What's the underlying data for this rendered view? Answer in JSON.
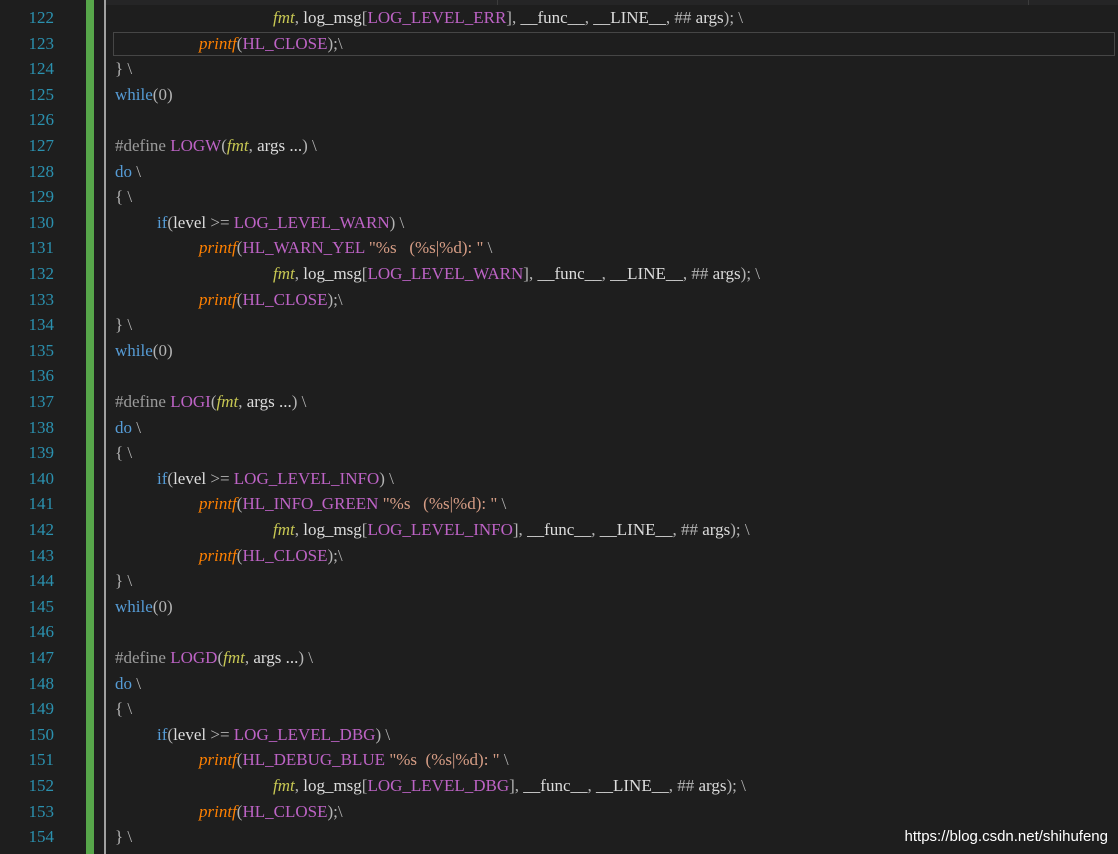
{
  "editor": {
    "watermark": "https://blog.csdn.net/shihufeng",
    "colors": {
      "background": "#1e1e1e",
      "line_number": "#2b91af",
      "keyword": "#569cd6",
      "macro": "#bd63c5",
      "function": "#ff8000",
      "parameter": "#c8c853",
      "string": "#d69d85",
      "preprocessor": "#9b9b9b",
      "change_bar": "#57a64a"
    },
    "line_numbers": [
      "122",
      "123",
      "124",
      "125",
      "126",
      "127",
      "128",
      "129",
      "130",
      "131",
      "132",
      "133",
      "134",
      "135",
      "136",
      "137",
      "138",
      "139",
      "140",
      "141",
      "142",
      "143",
      "144",
      "145",
      "146",
      "147",
      "148",
      "149",
      "150",
      "151",
      "152",
      "153",
      "154"
    ],
    "lines": [
      {
        "indent": 2,
        "tokens": [
          [
            "par",
            "fmt"
          ],
          [
            "op",
            ", "
          ],
          [
            "txt",
            "log_msg"
          ],
          [
            "op",
            "["
          ],
          [
            "mac",
            "LOG_LEVEL_ERR"
          ],
          [
            "op",
            "], "
          ],
          [
            "txt",
            "__func__"
          ],
          [
            "op",
            ", "
          ],
          [
            "txt",
            "__LINE__"
          ],
          [
            "op",
            ", "
          ],
          [
            "op",
            "## "
          ],
          [
            "txt",
            "args"
          ],
          [
            "op",
            "); \\"
          ]
        ]
      },
      {
        "indent": 1,
        "tokens": [
          [
            "fn",
            "printf"
          ],
          [
            "op",
            "("
          ],
          [
            "mac",
            "HL_CLOSE"
          ],
          [
            "op",
            ");\\"
          ]
        ]
      },
      {
        "indent": 0,
        "tokens": [
          [
            "op",
            "} \\"
          ]
        ]
      },
      {
        "indent": 0,
        "tokens": [
          [
            "kw",
            "while"
          ],
          [
            "op",
            "(0)"
          ]
        ]
      },
      {
        "indent": 0,
        "tokens": []
      },
      {
        "indent": 0,
        "tokens": [
          [
            "pp",
            "#define "
          ],
          [
            "mac",
            "LOGW"
          ],
          [
            "op",
            "("
          ],
          [
            "par",
            "fmt"
          ],
          [
            "op",
            ", "
          ],
          [
            "txt",
            "args ..."
          ],
          [
            "op",
            ") \\"
          ]
        ]
      },
      {
        "indent": 0,
        "tokens": [
          [
            "kw",
            "do"
          ],
          [
            "op",
            " \\"
          ]
        ]
      },
      {
        "indent": 0,
        "tokens": [
          [
            "op",
            "{ \\"
          ]
        ]
      },
      {
        "indent": 3,
        "tokens": [
          [
            "kw",
            "if"
          ],
          [
            "op",
            "("
          ],
          [
            "txt",
            "level"
          ],
          [
            "op",
            " >= "
          ],
          [
            "mac",
            "LOG_LEVEL_WARN"
          ],
          [
            "op",
            ") \\"
          ]
        ]
      },
      {
        "indent": 1,
        "tokens": [
          [
            "fn",
            "printf"
          ],
          [
            "op",
            "("
          ],
          [
            "mac",
            "HL_WARN_YEL"
          ],
          [
            "str",
            " \"%s   (%s|%d): \""
          ],
          [
            "op",
            " \\"
          ]
        ]
      },
      {
        "indent": 2,
        "tokens": [
          [
            "par",
            "fmt"
          ],
          [
            "op",
            ", "
          ],
          [
            "txt",
            "log_msg"
          ],
          [
            "op",
            "["
          ],
          [
            "mac",
            "LOG_LEVEL_WARN"
          ],
          [
            "op",
            "], "
          ],
          [
            "txt",
            "__func__"
          ],
          [
            "op",
            ", "
          ],
          [
            "txt",
            "__LINE__"
          ],
          [
            "op",
            ", "
          ],
          [
            "op",
            "## "
          ],
          [
            "txt",
            "args"
          ],
          [
            "op",
            "); \\"
          ]
        ]
      },
      {
        "indent": 1,
        "tokens": [
          [
            "fn",
            "printf"
          ],
          [
            "op",
            "("
          ],
          [
            "mac",
            "HL_CLOSE"
          ],
          [
            "op",
            ");\\"
          ]
        ]
      },
      {
        "indent": 0,
        "tokens": [
          [
            "op",
            "} \\"
          ]
        ]
      },
      {
        "indent": 0,
        "tokens": [
          [
            "kw",
            "while"
          ],
          [
            "op",
            "(0)"
          ]
        ]
      },
      {
        "indent": 0,
        "tokens": []
      },
      {
        "indent": 0,
        "tokens": [
          [
            "pp",
            "#define "
          ],
          [
            "mac",
            "LOGI"
          ],
          [
            "op",
            "("
          ],
          [
            "par",
            "fmt"
          ],
          [
            "op",
            ", "
          ],
          [
            "txt",
            "args ..."
          ],
          [
            "op",
            ") \\"
          ]
        ]
      },
      {
        "indent": 0,
        "tokens": [
          [
            "kw",
            "do"
          ],
          [
            "op",
            " \\"
          ]
        ]
      },
      {
        "indent": 0,
        "tokens": [
          [
            "op",
            "{ \\"
          ]
        ]
      },
      {
        "indent": 3,
        "tokens": [
          [
            "kw",
            "if"
          ],
          [
            "op",
            "("
          ],
          [
            "txt",
            "level"
          ],
          [
            "op",
            " >= "
          ],
          [
            "mac",
            "LOG_LEVEL_INFO"
          ],
          [
            "op",
            ") \\"
          ]
        ]
      },
      {
        "indent": 1,
        "tokens": [
          [
            "fn",
            "printf"
          ],
          [
            "op",
            "("
          ],
          [
            "mac",
            "HL_INFO_GREEN"
          ],
          [
            "str",
            " \"%s   (%s|%d): \""
          ],
          [
            "op",
            " \\"
          ]
        ]
      },
      {
        "indent": 2,
        "tokens": [
          [
            "par",
            "fmt"
          ],
          [
            "op",
            ", "
          ],
          [
            "txt",
            "log_msg"
          ],
          [
            "op",
            "["
          ],
          [
            "mac",
            "LOG_LEVEL_INFO"
          ],
          [
            "op",
            "], "
          ],
          [
            "txt",
            "__func__"
          ],
          [
            "op",
            ", "
          ],
          [
            "txt",
            "__LINE__"
          ],
          [
            "op",
            ", "
          ],
          [
            "op",
            "## "
          ],
          [
            "txt",
            "args"
          ],
          [
            "op",
            "); \\"
          ]
        ]
      },
      {
        "indent": 1,
        "tokens": [
          [
            "fn",
            "printf"
          ],
          [
            "op",
            "("
          ],
          [
            "mac",
            "HL_CLOSE"
          ],
          [
            "op",
            ");\\"
          ]
        ]
      },
      {
        "indent": 0,
        "tokens": [
          [
            "op",
            "} \\"
          ]
        ]
      },
      {
        "indent": 0,
        "tokens": [
          [
            "kw",
            "while"
          ],
          [
            "op",
            "(0)"
          ]
        ]
      },
      {
        "indent": 0,
        "tokens": []
      },
      {
        "indent": 0,
        "tokens": [
          [
            "pp",
            "#define "
          ],
          [
            "mac",
            "LOGD"
          ],
          [
            "op",
            "("
          ],
          [
            "par",
            "fmt"
          ],
          [
            "op",
            ", "
          ],
          [
            "txt",
            "args ..."
          ],
          [
            "op",
            ") \\"
          ]
        ]
      },
      {
        "indent": 0,
        "tokens": [
          [
            "kw",
            "do"
          ],
          [
            "op",
            " \\"
          ]
        ]
      },
      {
        "indent": 0,
        "tokens": [
          [
            "op",
            "{ \\"
          ]
        ]
      },
      {
        "indent": 3,
        "tokens": [
          [
            "kw",
            "if"
          ],
          [
            "op",
            "("
          ],
          [
            "txt",
            "level"
          ],
          [
            "op",
            " >= "
          ],
          [
            "mac",
            "LOG_LEVEL_DBG"
          ],
          [
            "op",
            ") \\"
          ]
        ]
      },
      {
        "indent": 1,
        "tokens": [
          [
            "fn",
            "printf"
          ],
          [
            "op",
            "("
          ],
          [
            "mac",
            "HL_DEBUG_BLUE"
          ],
          [
            "str",
            " \"%s  (%s|%d): \""
          ],
          [
            "op",
            " \\"
          ]
        ]
      },
      {
        "indent": 2,
        "tokens": [
          [
            "par",
            "fmt"
          ],
          [
            "op",
            ", "
          ],
          [
            "txt",
            "log_msg"
          ],
          [
            "op",
            "["
          ],
          [
            "mac",
            "LOG_LEVEL_DBG"
          ],
          [
            "op",
            "], "
          ],
          [
            "txt",
            "__func__"
          ],
          [
            "op",
            ", "
          ],
          [
            "txt",
            "__LINE__"
          ],
          [
            "op",
            ", "
          ],
          [
            "op",
            "## "
          ],
          [
            "txt",
            "args"
          ],
          [
            "op",
            "); \\"
          ]
        ]
      },
      {
        "indent": 1,
        "tokens": [
          [
            "fn",
            "printf"
          ],
          [
            "op",
            "("
          ],
          [
            "mac",
            "HL_CLOSE"
          ],
          [
            "op",
            ");\\"
          ]
        ]
      },
      {
        "indent": 0,
        "tokens": [
          [
            "op",
            "} \\"
          ]
        ]
      }
    ]
  }
}
